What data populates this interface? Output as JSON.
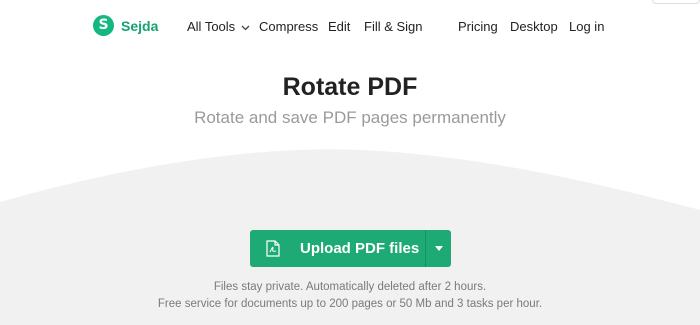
{
  "brand": {
    "logo_letter": "S",
    "name": "Sejda"
  },
  "nav": {
    "all_tools": "All Tools",
    "compress": "Compress",
    "edit": "Edit",
    "fill_sign": "Fill & Sign",
    "pricing": "Pricing",
    "desktop": "Desktop",
    "login": "Log in"
  },
  "hero": {
    "title": "Rotate PDF",
    "subtitle": "Rotate and save PDF pages permanently"
  },
  "upload": {
    "label": "Upload PDF files"
  },
  "notes": {
    "line1": "Files stay private. Automatically deleted after 2 hours.",
    "line2": "Free service for documents up to 200 pages or 50 Mb and 3 tasks per hour."
  },
  "colors": {
    "brand_green": "#14b77f",
    "button_green": "#1eaa75",
    "wave_gray": "#f1f1f1"
  },
  "icons": {
    "chevron": "chevron-down-icon",
    "file": "pdf-file-icon",
    "caret": "caret-down-icon"
  }
}
